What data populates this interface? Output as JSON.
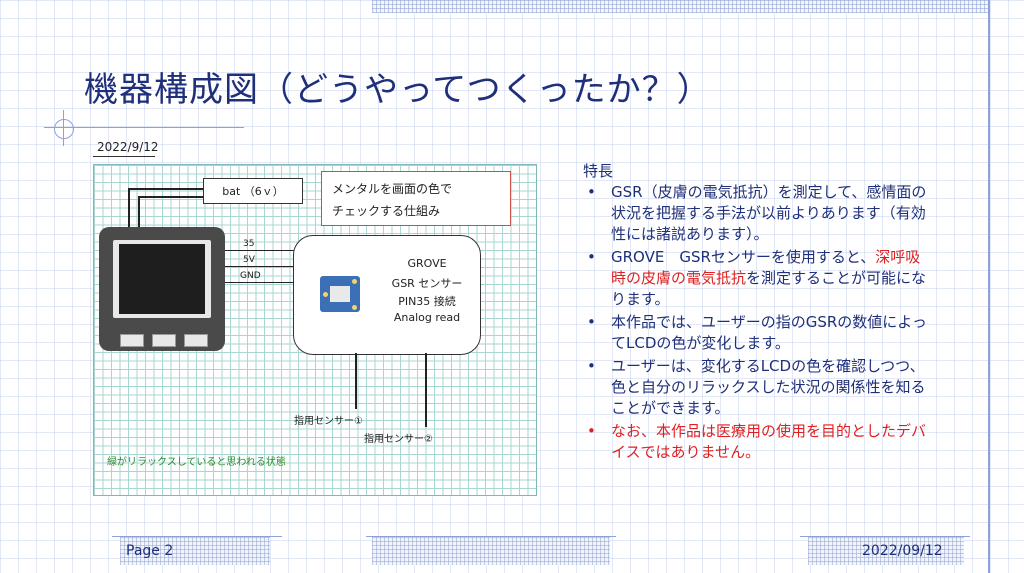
{
  "slide": {
    "title": "機器構成図（どうやってつくったか？）"
  },
  "diagram": {
    "date": "2022/9/12",
    "battery_label": "bat （6ｖ）",
    "note_line1": "メンタルを画面の色で",
    "note_line2": "チェックする仕組み",
    "pins": [
      "35",
      "5V",
      "GND"
    ],
    "gsr_lines": [
      "GROVE",
      "GSR センサー",
      "PIN35 接続",
      "Analog read"
    ],
    "sensor1": "指用センサー①",
    "sensor2": "指用センサー②",
    "green_note": "緑がリラックスしていると思われる状態"
  },
  "features": {
    "heading": "特長",
    "item1": "GSR（皮膚の電気抵抗）を測定して、感情面の状況を把握する手法が以前よりあります（有効性には諸説あります）。",
    "item2_pre": "GROVE　GSRセンサーを使用すると、",
    "item2_red": "深呼吸時の皮膚の電気抵抗",
    "item2_post": "を測定することが可能になります。",
    "item3": "本作品では、ユーザーの指のGSRの数値によってLCDの色が変化します。",
    "item4": "ユーザーは、変化するLCDの色を確認しつつ、色と自分のリラックスした状況の関係性を知ることができます。",
    "item5_pre": "なお、",
    "item5_red": "本作品は医療用の使用を目的としたデバイスではありません。",
    "colors": {
      "text": "#1f2f7a",
      "highlight": "#e02020"
    }
  },
  "footer": {
    "page": "Page 2",
    "date": "2022/09/12"
  }
}
